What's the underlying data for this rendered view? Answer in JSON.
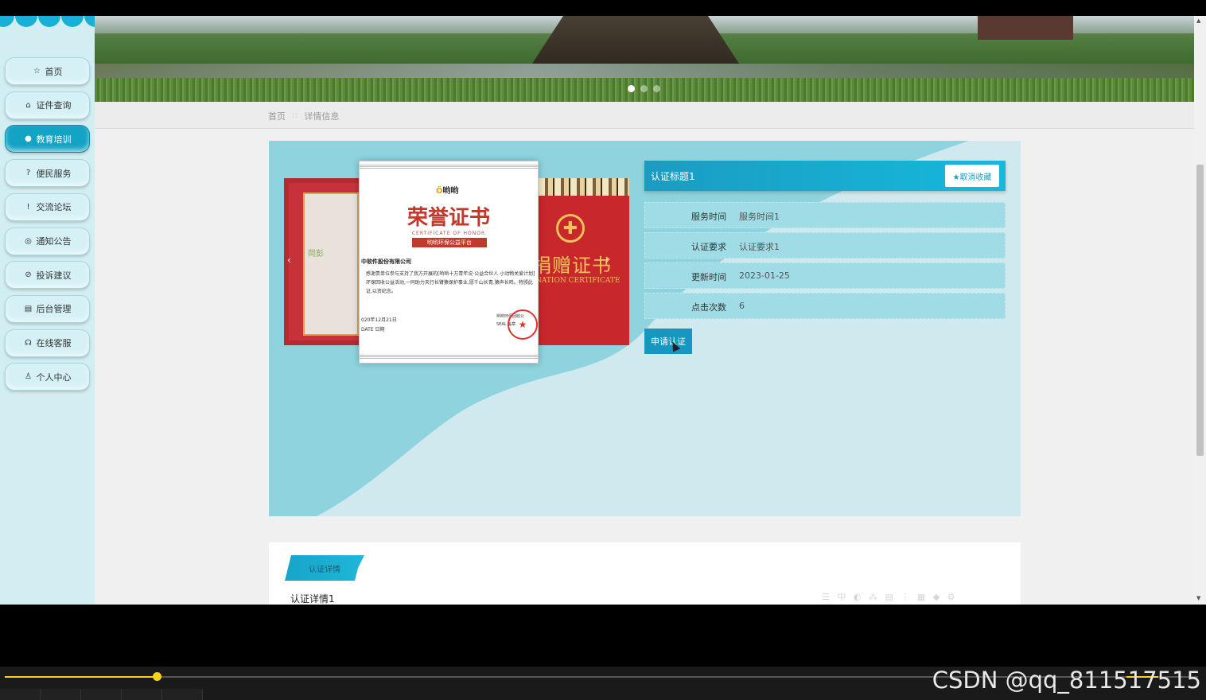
{
  "sidebar": {
    "items": [
      {
        "label": "首页",
        "icon": "☆",
        "active": false
      },
      {
        "label": "证件查询",
        "icon": "⌂",
        "active": false
      },
      {
        "label": "教育培训",
        "icon": "●",
        "active": true
      },
      {
        "label": "便民服务",
        "icon": "?",
        "active": false
      },
      {
        "label": "交流论坛",
        "icon": "!",
        "active": false
      },
      {
        "label": "通知公告",
        "icon": "◎",
        "active": false
      },
      {
        "label": "投诉建议",
        "icon": "⊘",
        "active": false
      },
      {
        "label": "后台管理",
        "icon": "▤",
        "active": false
      },
      {
        "label": "在线客服",
        "icon": "☊",
        "active": false
      },
      {
        "label": "个人中心",
        "icon": "♙",
        "active": false
      }
    ]
  },
  "breadcrumb": {
    "home": "首页",
    "separator": "::",
    "current": "详情信息"
  },
  "carousel": {
    "left_cert_text": "岡彭",
    "main_cert": {
      "logo_name": "哟哟",
      "title": "荣誉证书",
      "subtitle_en": "CERTIFICATE OF HONOR",
      "ribbon": "哟哟环保公益平台",
      "company": "中软件股份有限公司",
      "body": "感谢贵单位参与支持了我方开展的[哟哟十万青年说·公益合伙人 小动物关爱计划]环保回收公益活动,一同助力天行长臂猿保护事业,愿千山长青,猿声长鸣。特颁此证,以资纪念。",
      "date": "020年12月21日",
      "date_label": "DATE 日期",
      "seal_label": "SEAL 盖章",
      "seal_org": "哟哟环保回收公"
    },
    "right_cert": {
      "title": "捐赠证书",
      "subtitle_en": "NATION CERTIFICATE"
    },
    "prev_icon": "‹",
    "next_icon": "›"
  },
  "detail": {
    "title": "认证标题1",
    "favorite_button": "★取消收藏",
    "rows": [
      {
        "label": "服务时间",
        "value": "服务时间1"
      },
      {
        "label": "认证要求",
        "value": "认证要求1"
      },
      {
        "label": "更新时间",
        "value": "2023-01-25"
      },
      {
        "label": "点击次数",
        "value": "6"
      }
    ],
    "apply_button": "申请认证"
  },
  "description": {
    "tab": "认证详情",
    "text": "认证详情1"
  },
  "banner": {
    "slide_count": 3,
    "active_slide": 0
  },
  "player": {
    "progress": 0.127
  },
  "watermark": "CSDN @qq_811517515",
  "colors": {
    "accent": "#13a3c4",
    "panel_bg": "#8ed3de",
    "sidebar_bg": "#d3eef2",
    "progress": "#f5d21c"
  }
}
